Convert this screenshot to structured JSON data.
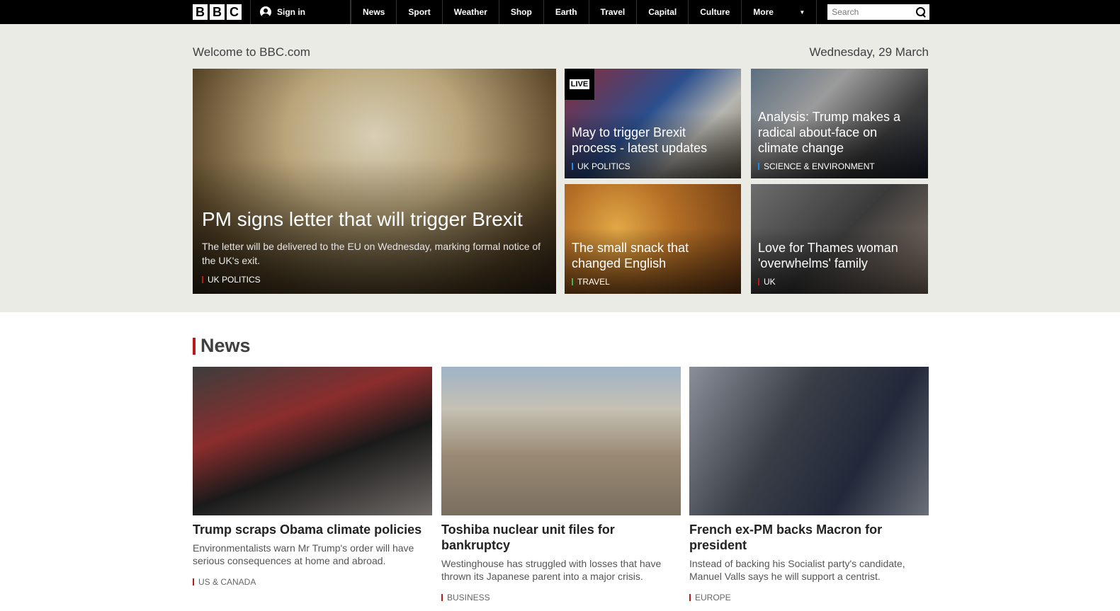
{
  "topbar": {
    "logo_letters": [
      "B",
      "B",
      "C"
    ],
    "signin_label": "Sign in",
    "nav": [
      "News",
      "Sport",
      "Weather",
      "Shop",
      "Earth",
      "Travel",
      "Capital",
      "Culture"
    ],
    "more_label": "More",
    "search_placeholder": "Search"
  },
  "hero": {
    "welcome": "Welcome to BBC.com",
    "date": "Wednesday, 29 March",
    "main": {
      "title": "PM signs letter that will trigger Brexit",
      "summary": "The letter will be delivered to the EU on Wednesday, marking formal notice of the UK's exit.",
      "tag": "UK POLITICS",
      "tag_color": "#bb1919"
    },
    "tiles": [
      {
        "title": "May to trigger Brexit process - latest updates",
        "tag": "UK POLITICS",
        "tag_color": "#1e88e5",
        "live": "LIVE"
      },
      {
        "title": "Analysis: Trump makes a radical about-face on climate change",
        "tag": "SCIENCE & ENVIRONMENT",
        "tag_color": "#1e88e5"
      },
      {
        "title": "The small snack that changed English",
        "tag": "TRAVEL",
        "tag_color": "#4caf50"
      },
      {
        "title": "Love for Thames woman 'overwhelms' family",
        "tag": "UK",
        "tag_color": "#bb1919"
      }
    ]
  },
  "news": {
    "heading": "News",
    "accent": "#bb1919",
    "cards": [
      {
        "title": "Trump scraps Obama climate policies",
        "summary": "Environmentalists warn Mr Trump's order will have serious consequences at home and abroad.",
        "tag": "US & CANADA"
      },
      {
        "title": "Toshiba nuclear unit files for bankruptcy",
        "summary": "Westinghouse has struggled with losses that have thrown its Japanese parent into a major crisis.",
        "tag": "BUSINESS"
      },
      {
        "title": "French ex-PM backs Macron for president",
        "summary": "Instead of backing his Socialist party's candidate, Manuel Valls says he will support a centrist.",
        "tag": "EUROPE"
      }
    ]
  }
}
